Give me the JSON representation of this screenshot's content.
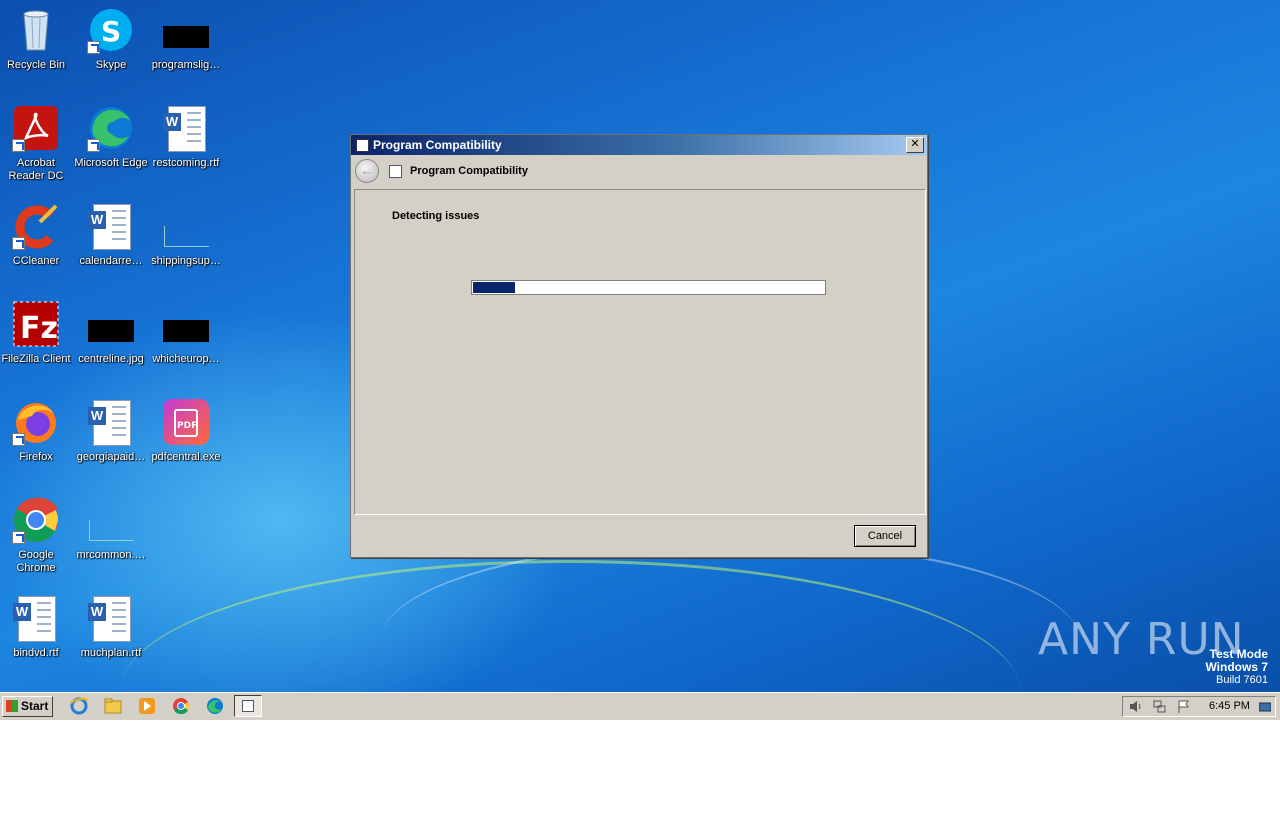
{
  "desktop": {
    "icons": [
      {
        "label": "Recycle Bin",
        "icon": "recycle-bin-icon"
      },
      {
        "label": "Skype",
        "icon": "skype-icon"
      },
      {
        "label": "programslig…",
        "icon": "black-image-icon"
      },
      {
        "label": "Acrobat Reader DC",
        "icon": "acrobat-icon"
      },
      {
        "label": "Microsoft Edge",
        "icon": "edge-icon"
      },
      {
        "label": "restcoming.rtf",
        "icon": "word-document-icon"
      },
      {
        "label": "CCleaner",
        "icon": "ccleaner-icon"
      },
      {
        "label": "calendarre…",
        "icon": "word-document-icon"
      },
      {
        "label": "shippingsup…",
        "icon": "blank-file-icon"
      },
      {
        "label": "FileZilla Client",
        "icon": "filezilla-icon"
      },
      {
        "label": "centreline.jpg",
        "icon": "black-image-icon"
      },
      {
        "label": "whicheurop…",
        "icon": "black-image-icon"
      },
      {
        "label": "Firefox",
        "icon": "firefox-icon"
      },
      {
        "label": "georgiapaid…",
        "icon": "word-document-icon"
      },
      {
        "label": "pdfcentral.exe",
        "icon": "pdfcentral-icon"
      },
      {
        "label": "Google Chrome",
        "icon": "chrome-icon"
      },
      {
        "label": "mrcommon.…",
        "icon": "blank-file-icon"
      },
      {
        "label": "bindvd.rtf",
        "icon": "word-document-icon"
      },
      {
        "label": "muchplan.rtf",
        "icon": "word-document-icon"
      }
    ]
  },
  "dialog": {
    "title": "Program Compatibility",
    "close_label": "✕",
    "nav_title": "Program Compatibility",
    "heading": "Detecting issues",
    "progress": 0.12,
    "cancel_label": "Cancel"
  },
  "taskbar": {
    "start_label": "Start",
    "pinned": [
      "internet-explorer-icon",
      "explorer-icon",
      "media-player-icon",
      "chrome-icon",
      "edge-icon",
      "program-compatibility-icon"
    ],
    "clock": "6:45 PM"
  },
  "watermark": {
    "line1": "Test Mode",
    "line2": "Windows 7",
    "line3": "Build 7601",
    "brand": "ANY RUN"
  },
  "colors": {
    "titlebar_start": "#0a246a",
    "progress_fill": "#0a246a",
    "desktop_blue": "#1774d6"
  }
}
